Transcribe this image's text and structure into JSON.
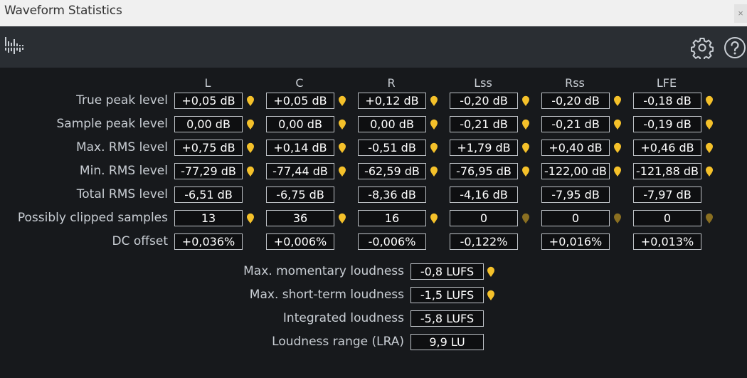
{
  "window": {
    "title": "Waveform Statistics",
    "close_glyph": "×"
  },
  "toolbar": {
    "left_icon": "waveform-icon",
    "right_icons": [
      "gear-icon",
      "help-icon"
    ]
  },
  "colors": {
    "marker_active": "#f5c12a",
    "marker_inactive": "#8a6f21",
    "background": "#17191c",
    "toolbar": "#2a2e33"
  },
  "columns": [
    "L",
    "C",
    "R",
    "Lss",
    "Rss",
    "LFE"
  ],
  "rows": [
    {
      "label": "True peak level",
      "values": [
        "+0,05 dB",
        "+0,05 dB",
        "+0,12 dB",
        "-0,20 dB",
        "-0,20 dB",
        "-0,18 dB"
      ],
      "markers": [
        "active",
        "active",
        "active",
        "active",
        "active",
        "active"
      ]
    },
    {
      "label": "Sample peak level",
      "values": [
        "0,00 dB",
        "0,00 dB",
        "0,00 dB",
        "-0,21 dB",
        "-0,21 dB",
        "-0,19 dB"
      ],
      "markers": [
        "active",
        "active",
        "active",
        "active",
        "active",
        "active"
      ]
    },
    {
      "label": "Max. RMS level",
      "values": [
        "+0,75 dB",
        "+0,14 dB",
        "-0,51 dB",
        "+1,79 dB",
        "+0,40 dB",
        "+0,46 dB"
      ],
      "markers": [
        "active",
        "active",
        "active",
        "active",
        "active",
        "active"
      ]
    },
    {
      "label": "Min. RMS level",
      "values": [
        "-77,29 dB",
        "-77,44 dB",
        "-62,59 dB",
        "-76,95 dB",
        "-122,00 dB",
        "-121,88 dB"
      ],
      "markers": [
        "active",
        "active",
        "active",
        "active",
        "active",
        "active"
      ]
    },
    {
      "label": "Total RMS level",
      "values": [
        "-6,51 dB",
        "-6,75 dB",
        "-8,36 dB",
        "-4,16 dB",
        "-7,95 dB",
        "-7,97 dB"
      ],
      "markers": [
        "none",
        "none",
        "none",
        "none",
        "none",
        "none"
      ]
    },
    {
      "label": "Possibly clipped samples",
      "values": [
        "13",
        "36",
        "16",
        "0",
        "0",
        "0"
      ],
      "markers": [
        "active",
        "active",
        "active",
        "inactive",
        "inactive",
        "inactive"
      ]
    },
    {
      "label": "DC offset",
      "values": [
        "+0,036%",
        "+0,006%",
        "-0,006%",
        "-0,122%",
        "+0,016%",
        "+0,013%"
      ],
      "markers": [
        "none",
        "none",
        "none",
        "none",
        "none",
        "none"
      ]
    }
  ],
  "loudness": [
    {
      "label": "Max. momentary loudness",
      "value": "-0,8 LUFS",
      "marker": "active"
    },
    {
      "label": "Max. short-term loudness",
      "value": "-1,5 LUFS",
      "marker": "active"
    },
    {
      "label": "Integrated loudness",
      "value": "-5,8 LUFS",
      "marker": "none"
    },
    {
      "label": "Loudness range (LRA)",
      "value": "9,9 LU",
      "marker": "none"
    }
  ]
}
